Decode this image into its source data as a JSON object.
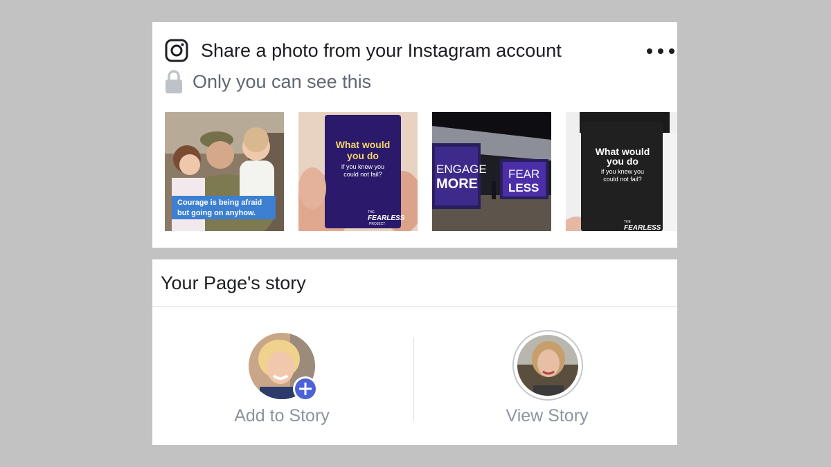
{
  "instagram_card": {
    "title": "Share a photo from your Instagram account",
    "privacy_text": "Only you can see this",
    "photos": [
      {
        "icon": "family-photo",
        "overlay_lines": [
          "Courage is being afraid",
          "but going on anyhow."
        ]
      },
      {
        "icon": "card-photo",
        "heading_lines": [
          "What would",
          "you do"
        ],
        "body_lines": [
          "if you knew you",
          "could not fail?"
        ],
        "brand_top": "THE",
        "brand": "FEARLESS",
        "brand_bottom": "PROJECT"
      },
      {
        "icon": "event-banner-photo",
        "banner_left": [
          "ENGAGE",
          "MORE"
        ],
        "banner_right": [
          "FEAR",
          "LESS"
        ]
      },
      {
        "icon": "card-photo",
        "heading_lines": [
          "What would",
          "you do"
        ],
        "body_lines": [
          "if you knew you",
          "could not fail?"
        ],
        "brand_top": "THE",
        "brand": "FEARLESS"
      }
    ]
  },
  "story_card": {
    "title": "Your Page's story",
    "add_story_label": "Add to Story",
    "view_story_label": "View Story",
    "accent_color": "#4b63d6"
  }
}
